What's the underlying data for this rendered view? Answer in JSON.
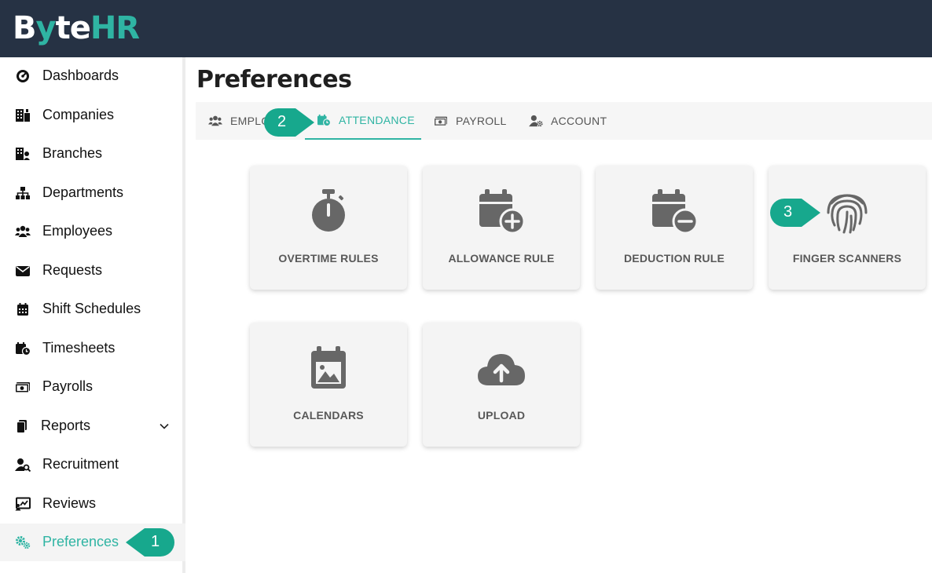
{
  "app": {
    "logo_parts": [
      "B",
      "y",
      "te",
      "HR"
    ]
  },
  "sidebar": {
    "items": [
      {
        "label": "Dashboards",
        "icon": "gauge-icon"
      },
      {
        "label": "Companies",
        "icon": "building-icon"
      },
      {
        "label": "Branches",
        "icon": "branch-building-icon"
      },
      {
        "label": "Departments",
        "icon": "sitemap-icon"
      },
      {
        "label": "Employees",
        "icon": "users-icon"
      },
      {
        "label": "Requests",
        "icon": "envelope-icon"
      },
      {
        "label": "Shift Schedules",
        "icon": "calendar-icon"
      },
      {
        "label": "Timesheets",
        "icon": "calendar-clock-icon"
      },
      {
        "label": "Payrolls",
        "icon": "money-icon"
      },
      {
        "label": "Reports",
        "icon": "file-icon"
      },
      {
        "label": "Recruitment",
        "icon": "user-search-icon"
      },
      {
        "label": "Reviews",
        "icon": "chart-board-icon"
      },
      {
        "label": "Preferences",
        "icon": "gears-icon"
      }
    ],
    "active": "Preferences"
  },
  "page": {
    "title": "Preferences"
  },
  "tabs": [
    {
      "label": "EMPLO",
      "icon": "users-icon"
    },
    {
      "label": "ATTENDANCE",
      "icon": "calendar-clock-icon"
    },
    {
      "label": "PAYROLL",
      "icon": "money-icon"
    },
    {
      "label": "ACCOUNT",
      "icon": "user-gear-icon"
    }
  ],
  "cards": [
    {
      "label": "OVERTIME RULES",
      "icon": "stopwatch-icon"
    },
    {
      "label": "ALLOWANCE RULE",
      "icon": "calendar-plus-icon"
    },
    {
      "label": "DEDUCTION RULE",
      "icon": "calendar-minus-icon"
    },
    {
      "label": "FINGER SCANNERS",
      "icon": "fingerprint-icon"
    },
    {
      "label": "CALENDARS",
      "icon": "calendar-image-icon"
    },
    {
      "label": "UPLOAD",
      "icon": "cloud-upload-icon"
    }
  ],
  "callouts": [
    "1",
    "2",
    "3"
  ],
  "colors": {
    "topbar": "#263244",
    "accent": "#2fb4a3",
    "callout": "#17a88d",
    "card_bg": "#f4f4f4",
    "icon_gray": "#676767"
  }
}
